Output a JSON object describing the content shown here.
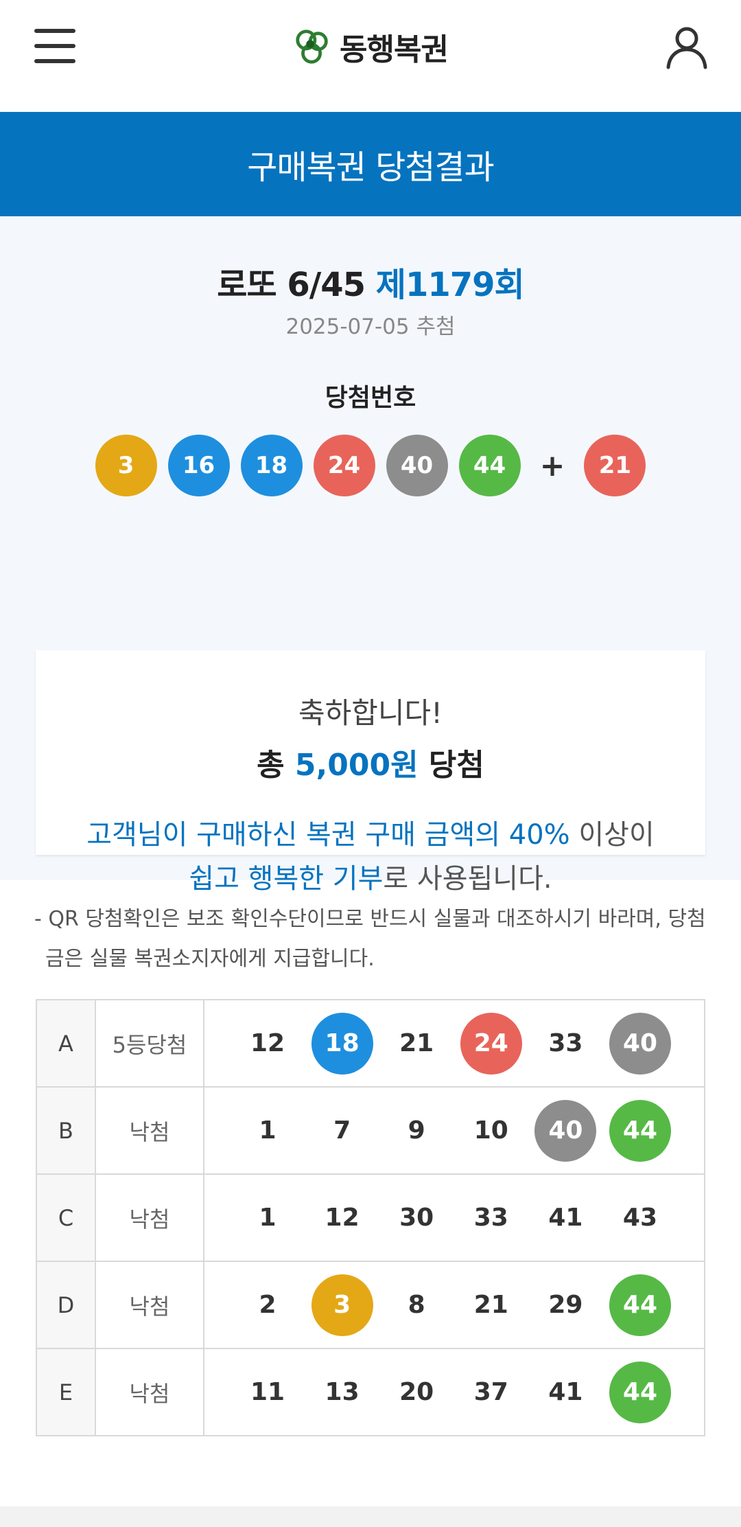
{
  "header": {
    "brand_name": "동행복권",
    "menu_icon": "hamburger-menu-icon",
    "user_icon": "user-icon"
  },
  "banner": {
    "title": "구매복권 당첨결과"
  },
  "draw": {
    "game": "로또 6/45",
    "round": "제1179회",
    "date": "2025-07-05 추첨",
    "winning_label": "당첨번호",
    "winning_numbers": [
      {
        "n": "3",
        "color": "#e4a816"
      },
      {
        "n": "16",
        "color": "#1e8fde"
      },
      {
        "n": "18",
        "color": "#1e8fde"
      },
      {
        "n": "24",
        "color": "#e8645a"
      },
      {
        "n": "40",
        "color": "#8d8d8d"
      },
      {
        "n": "44",
        "color": "#56b946"
      }
    ],
    "plus": "+",
    "bonus": {
      "n": "21",
      "color": "#e8645a"
    }
  },
  "result": {
    "congrats": "축하합니다!",
    "total_prefix": "총",
    "total_amount": "5,000원",
    "total_suffix": "당첨",
    "donation_line1_hl": "고객님이 구매하신 복권 구매 금액의 40%",
    "donation_line1_rest": " 이상이",
    "donation_line2_hl": "쉽고 행복한 기부",
    "donation_line2_rest": "로 사용됩니다."
  },
  "notice": "- QR 당첨확인은 보조 확인수단이므로 반드시 실물과 대조하시기 바라며, 당첨금은 실물 복권소지자에게 지급합니다.",
  "lines": [
    {
      "label": "A",
      "status": "5등당첨",
      "numbers": [
        {
          "n": "12",
          "color": null
        },
        {
          "n": "18",
          "color": "#1e8fde"
        },
        {
          "n": "21",
          "color": null
        },
        {
          "n": "24",
          "color": "#e8645a"
        },
        {
          "n": "33",
          "color": null
        },
        {
          "n": "40",
          "color": "#8d8d8d"
        }
      ]
    },
    {
      "label": "B",
      "status": "낙첨",
      "numbers": [
        {
          "n": "1",
          "color": null
        },
        {
          "n": "7",
          "color": null
        },
        {
          "n": "9",
          "color": null
        },
        {
          "n": "10",
          "color": null
        },
        {
          "n": "40",
          "color": "#8d8d8d"
        },
        {
          "n": "44",
          "color": "#56b946"
        }
      ]
    },
    {
      "label": "C",
      "status": "낙첨",
      "numbers": [
        {
          "n": "1",
          "color": null
        },
        {
          "n": "12",
          "color": null
        },
        {
          "n": "30",
          "color": null
        },
        {
          "n": "33",
          "color": null
        },
        {
          "n": "41",
          "color": null
        },
        {
          "n": "43",
          "color": null
        }
      ]
    },
    {
      "label": "D",
      "status": "낙첨",
      "numbers": [
        {
          "n": "2",
          "color": null
        },
        {
          "n": "3",
          "color": "#e4a816"
        },
        {
          "n": "8",
          "color": null
        },
        {
          "n": "21",
          "color": null
        },
        {
          "n": "29",
          "color": null
        },
        {
          "n": "44",
          "color": "#56b946"
        }
      ]
    },
    {
      "label": "E",
      "status": "낙첨",
      "numbers": [
        {
          "n": "11",
          "color": null
        },
        {
          "n": "13",
          "color": null
        },
        {
          "n": "20",
          "color": null
        },
        {
          "n": "37",
          "color": null
        },
        {
          "n": "41",
          "color": null
        },
        {
          "n": "44",
          "color": "#56b946"
        }
      ]
    }
  ]
}
